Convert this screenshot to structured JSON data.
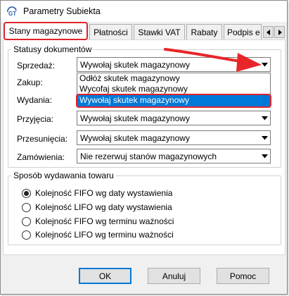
{
  "window": {
    "title": "Parametry Subiekta",
    "app_icon": "gt-app-icon"
  },
  "tabs": [
    {
      "label": "Stany magazynowe",
      "active": true
    },
    {
      "label": "Płatności",
      "active": false
    },
    {
      "label": "Stawki VAT",
      "active": false
    },
    {
      "label": "Rabaty",
      "active": false
    },
    {
      "label": "Podpis e",
      "active": false
    }
  ],
  "tab_scroll": {
    "left_icon": "triangle-left-icon",
    "right_icon": "triangle-right-icon"
  },
  "status_group": {
    "legend": "Statusy dokumentów",
    "rows": [
      {
        "label": "Sprzedaż:",
        "value": "Wywołaj skutek magazynowy"
      },
      {
        "label": "Zakup:",
        "value": ""
      },
      {
        "label": "Wydania:",
        "value": ""
      },
      {
        "label": "Przyjęcia:",
        "value": "Wywołaj skutek magazynowy"
      },
      {
        "label": "Przesunięcia:",
        "value": "Wywołaj skutek magazynowy"
      },
      {
        "label": "Zamówienia:",
        "value": "Nie rezerwuj stanów magazynowych"
      }
    ],
    "dropdown_options": [
      "Odłóż skutek magazynowy",
      "Wycofaj skutek magazynowy",
      "Wywołaj skutek magazynowy"
    ],
    "dropdown_selected_index": 2
  },
  "issue_group": {
    "legend": "Sposób wydawania towaru",
    "options": [
      {
        "label": "Kolejność FIFO wg daty wystawienia",
        "checked": true
      },
      {
        "label": "Kolejność LIFO wg daty wystawienia",
        "checked": false
      },
      {
        "label": "Kolejność FIFO wg terminu ważności",
        "checked": false
      },
      {
        "label": "Kolejność LIFO wg terminu ważności",
        "checked": false
      }
    ]
  },
  "buttons": {
    "ok": "OK",
    "cancel": "Anuluj",
    "help": "Pomoc"
  },
  "colors": {
    "highlight": "#e0242a",
    "selection": "#0078d7",
    "annotation_arrow": "#e8262a"
  }
}
